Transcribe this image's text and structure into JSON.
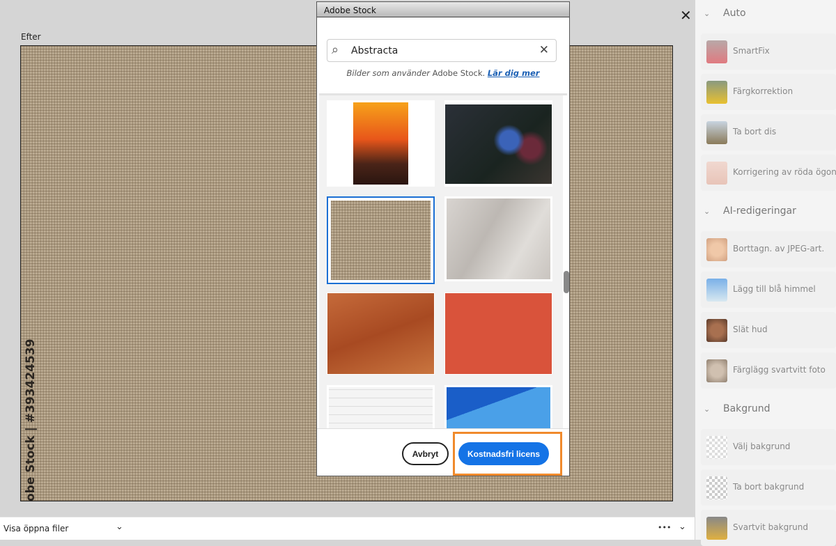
{
  "editor": {
    "view_label": "Efter",
    "watermark": "obe Stock | #393424539",
    "close_label": "✕"
  },
  "bottom_bar": {
    "open_files_label": "Visa öppna filer",
    "more_label": "•••"
  },
  "right_panel": {
    "sections": [
      {
        "title": "Auto",
        "items": [
          "SmartFix",
          "Färgkorrektion",
          "Ta bort dis",
          "Korrigering av röda ögon"
        ]
      },
      {
        "title": "AI-redigeringar",
        "items": [
          "Borttagn. av JPEG-art.",
          "Lägg till blå himmel",
          "Slät hud",
          "Färglägg svartvitt foto"
        ]
      },
      {
        "title": "Bakgrund",
        "items": [
          "Välj bakgrund",
          "Ta bort bakgrund",
          "Svartvit bakgrund"
        ]
      }
    ]
  },
  "dialog": {
    "title": "Adobe Stock",
    "search_value": "Abstracta",
    "subtitle_prefix": "Bilder som använder",
    "subtitle_brand": "Adobe Stock.",
    "learn_more": "Lär dig mer",
    "cancel_label": "Avbryt",
    "license_label": "Kostnadsfri licens",
    "accent": "#1473e6",
    "highlight": "#f08a2c"
  }
}
